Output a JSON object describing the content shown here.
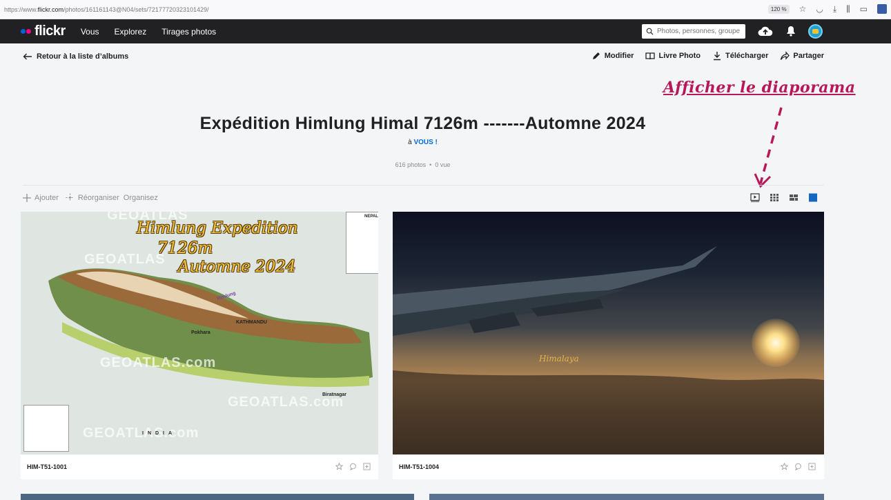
{
  "browser": {
    "url_prefix": "https://www.",
    "url_domain": "flickr.com",
    "url_path": "/photos/161161143@N04/sets/72177720323101429/",
    "zoom": "120 %"
  },
  "nav": {
    "logo": "flickr",
    "links": [
      "Vous",
      "Explorez",
      "Tirages photos"
    ],
    "search_placeholder": "Photos, personnes, groupes"
  },
  "subheader": {
    "back_label": "Retour à la liste d’albums",
    "actions": [
      "Modifier",
      "Livre Photo",
      "Télécharger",
      "Partager"
    ]
  },
  "annotation": "Afficher le diaporama",
  "album": {
    "title": "Expédition Himlung Himal 7126m -------Automne 2024",
    "byline_prefix": "à",
    "owner": "VOUS !",
    "photo_count": "616 photos",
    "separator": "•",
    "views": "0 vue"
  },
  "toolbar": {
    "add": "Ajouter",
    "reorder": "Réorganiser",
    "organize": "Organisez"
  },
  "photos": [
    {
      "caption": "HIM-T51-1001",
      "overlay_lines": [
        "Himlung Expedition",
        "7126m",
        "Automne 2024"
      ],
      "map_labels": {
        "country": "NEPAL",
        "capital": "KATHMANDU",
        "city": "Biratnagar",
        "region": "INDIA",
        "peak": "Himlung",
        "pokhara": "Pokhara"
      },
      "watermark": "GEOATLAS",
      "watermark_domain": "GEOATLAS.com"
    },
    {
      "caption": "HIM-T51-1004",
      "overlay_text": "Himalaya"
    }
  ],
  "colors": {
    "nav_bg": "#212124",
    "accent_blue": "#0063dc",
    "accent_pink": "#ff0084",
    "annotation": "#b8185a"
  }
}
